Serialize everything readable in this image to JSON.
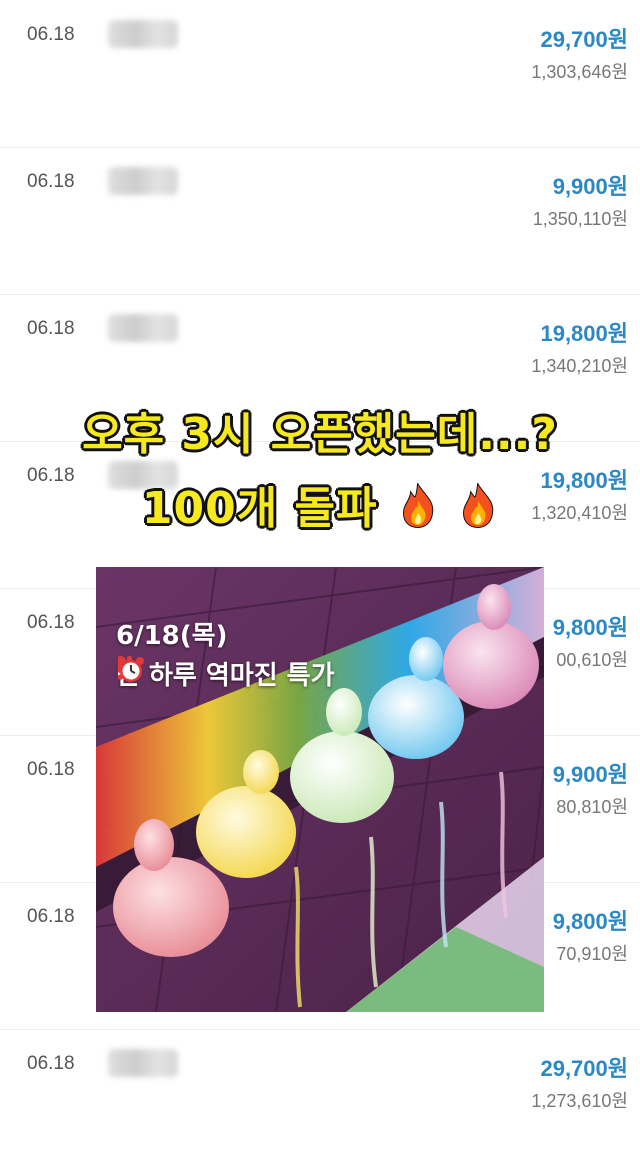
{
  "rows": [
    {
      "date": "06.18",
      "price": "29,700원",
      "total": "1,303,646원"
    },
    {
      "date": "06.18",
      "price": "9,900원",
      "total": "1,350,110원"
    },
    {
      "date": "06.18",
      "price": "19,800원",
      "total": "1,340,210원"
    },
    {
      "date": "06.18",
      "price": "19,800원",
      "total": "1,320,410원"
    },
    {
      "date": "06.18",
      "price": "9,800원",
      "total": "00,610원"
    },
    {
      "date": "06.18",
      "price": "9,900원",
      "total": "80,810원"
    },
    {
      "date": "06.18",
      "price": "9,800원",
      "total": "70,910원"
    },
    {
      "date": "06.18",
      "price": "29,700원",
      "total": "1,273,610원"
    }
  ],
  "headline": {
    "line1": "오후 3시 오픈했는데...?",
    "line2": "100개 돌파"
  },
  "promo": {
    "date_line": "6/18(목)",
    "text_before": "단 하루",
    "text_after": " 역마진 특가"
  },
  "icons": {
    "flame": "fire-icon",
    "exclamation": "double-exclamation-icon",
    "alarm": "alarm-clock-icon"
  },
  "colors": {
    "price_blue": "#2b88c4",
    "headline_yellow": "#f6ea1e"
  }
}
